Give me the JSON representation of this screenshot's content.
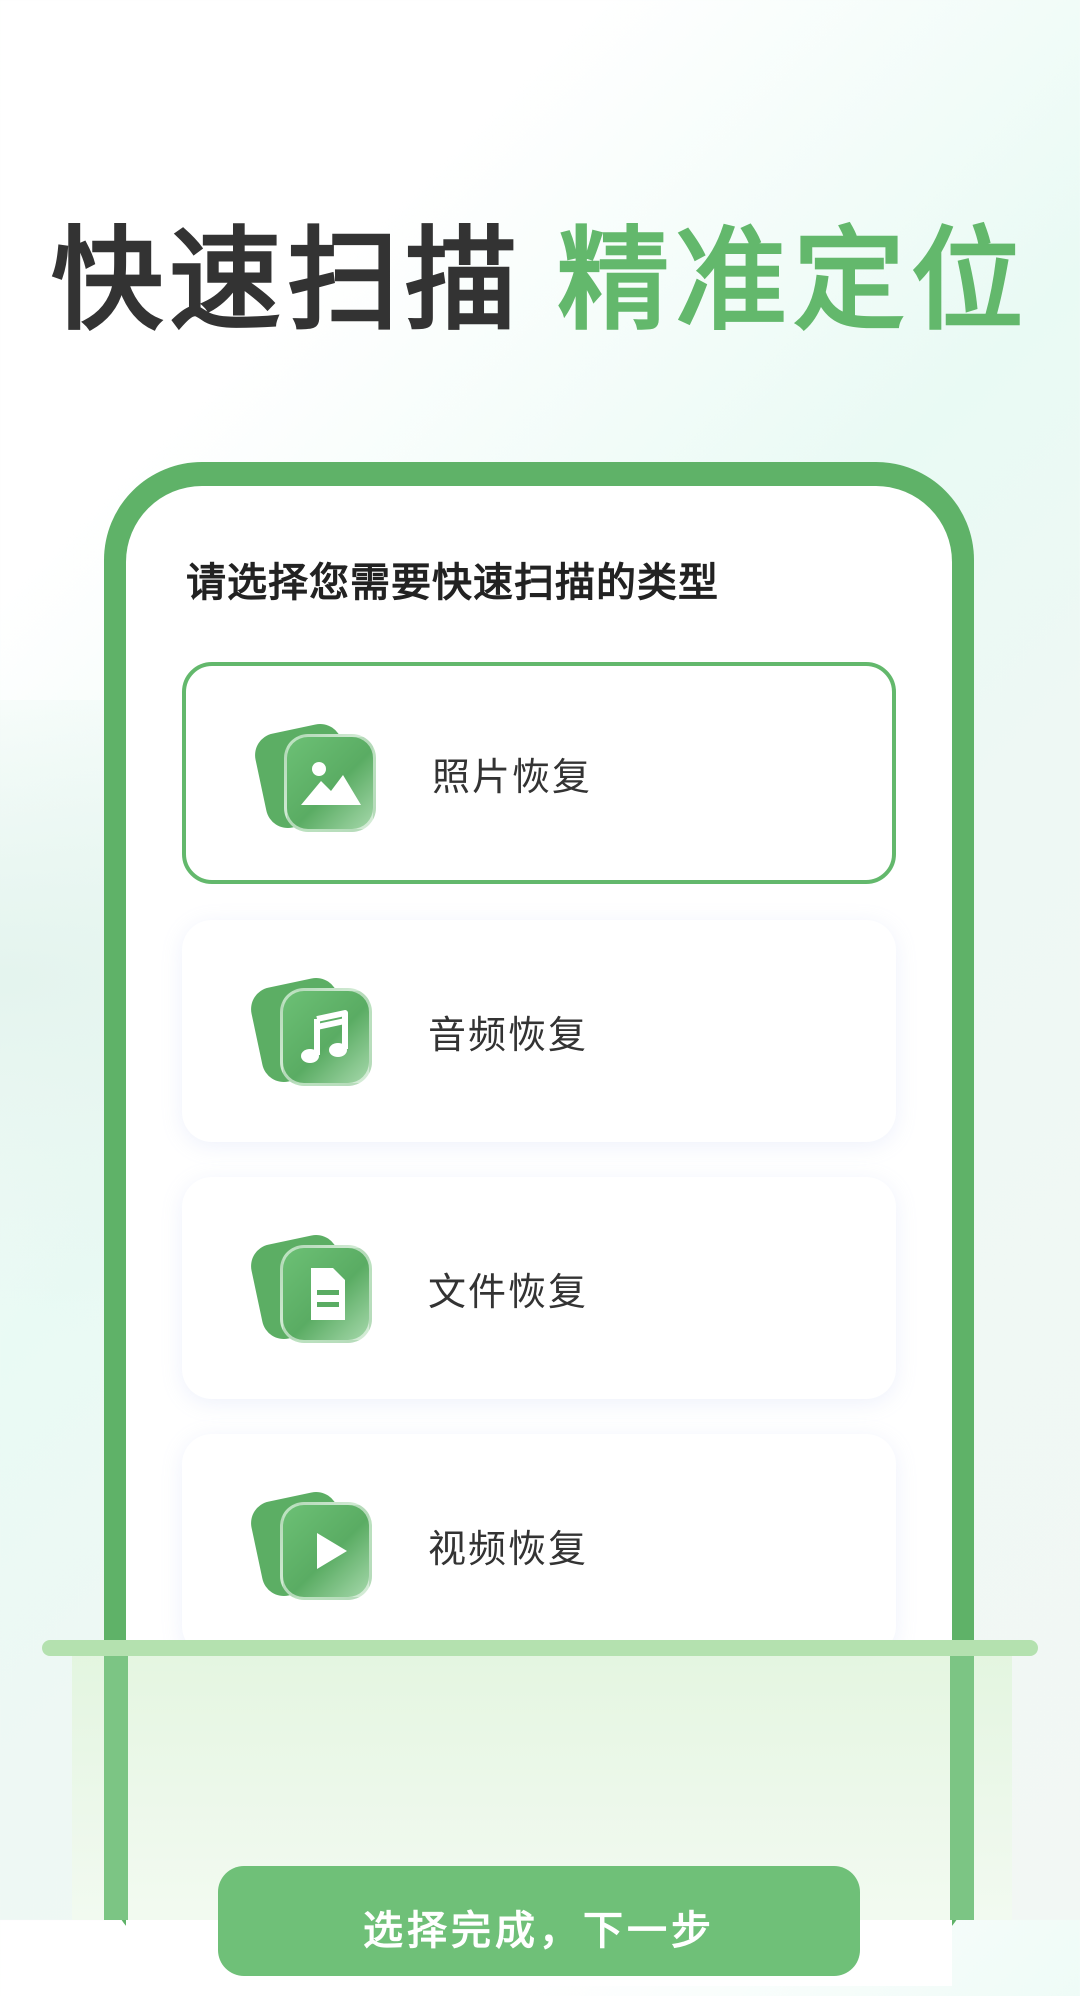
{
  "headline": {
    "part1": "快速扫描",
    "part2": "精准定位"
  },
  "prompt": "请选择您需要快速扫描的类型",
  "options": [
    {
      "label": "照片恢复",
      "icon": "photo-icon",
      "selected": true
    },
    {
      "label": "音频恢复",
      "icon": "music-note-icon",
      "selected": false
    },
    {
      "label": "文件恢复",
      "icon": "document-icon",
      "selected": false
    },
    {
      "label": "视频恢复",
      "icon": "play-icon",
      "selected": false
    }
  ],
  "cta": {
    "label": "选择完成，下一步"
  },
  "colors": {
    "accent": "#63b86c",
    "frame": "#5fb268",
    "text_dark": "#333333"
  }
}
